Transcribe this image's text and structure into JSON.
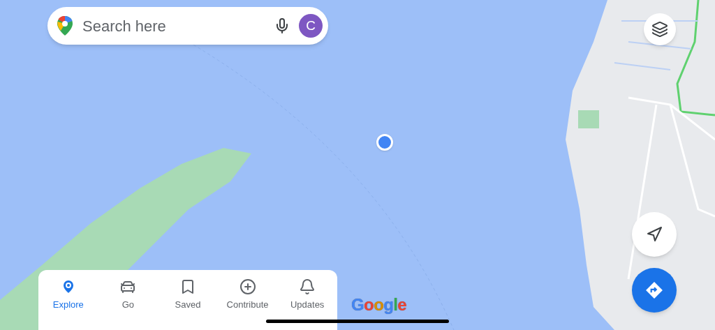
{
  "search": {
    "placeholder": "Search here"
  },
  "account": {
    "initial": "C"
  },
  "logo": "Google",
  "nav": [
    {
      "label": "Explore",
      "selected": true
    },
    {
      "label": "Go",
      "selected": false
    },
    {
      "label": "Saved",
      "selected": false
    },
    {
      "label": "Contribute",
      "selected": false
    },
    {
      "label": "Updates",
      "selected": false
    }
  ]
}
